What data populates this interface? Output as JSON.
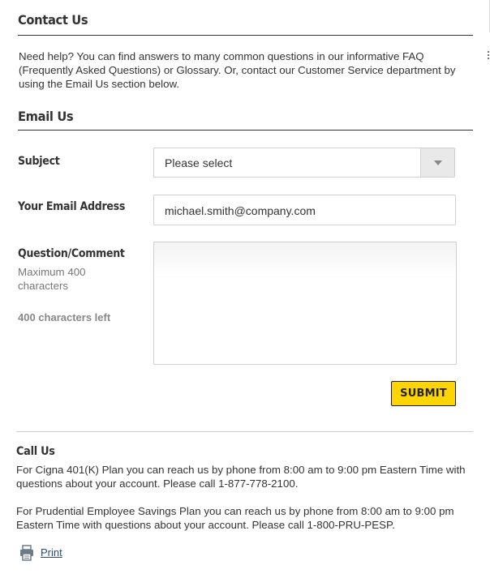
{
  "contact": {
    "title": "Contact Us",
    "intro": "Need help? You can find answers to many common questions in our informative FAQ (Frequently Asked Questions) or Glossary. Or, contact our Customer Service department by using the Email Us section below."
  },
  "email_form": {
    "title": "Email Us",
    "subject_label": "Subject",
    "subject_value": "Please select",
    "email_label": "Your Email Address",
    "email_value": "michael.smith@company.com",
    "question_label": "Question/Comment",
    "question_hint": "Maximum 400 characters",
    "question_value": "",
    "characters_left": "400 characters left",
    "submit_label": "SUBMIT"
  },
  "call_us": {
    "title": "Call Us",
    "paragraph1": "For Cigna 401(K) Plan you can reach us by phone from 8:00 am to 9:00 pm Eastern Time with questions about your account. Please call 1-877-778-2100.",
    "paragraph2": "For Prudential Employee Savings Plan you can reach us by phone from 8:00 am to 9:00 pm Eastern Time with questions about your account. Please call 1-800-PRU-PESP."
  },
  "print": {
    "label": "Print",
    "icon": "printer-icon"
  },
  "colors": {
    "accent": "#ffd500",
    "heading": "#333333",
    "link": "#2a4a7a"
  }
}
